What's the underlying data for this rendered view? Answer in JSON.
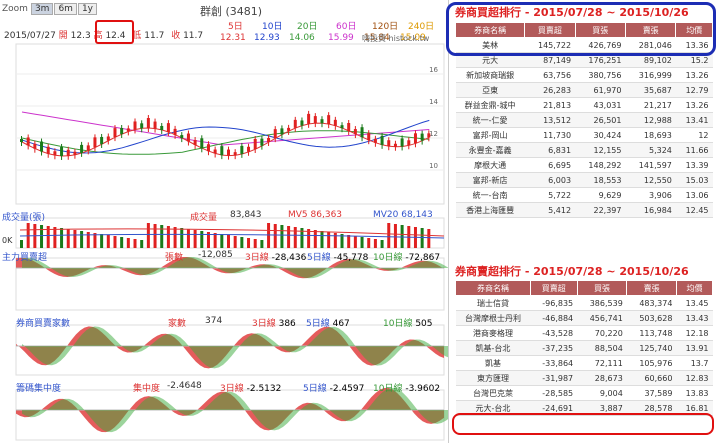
{
  "zoom": {
    "label": "Zoom",
    "buttons": [
      "3m",
      "6m",
      "1y"
    ]
  },
  "stock": {
    "title": "群創 (3481)"
  },
  "info": {
    "date": "2015/07/27",
    "open_label": "開",
    "open": "12.3",
    "high_label": "高",
    "high": "12.4",
    "low_label": "低",
    "low": "11.7",
    "close_label": "收",
    "close": "11.7"
  },
  "ma": [
    {
      "label": "5日",
      "value": "12.31",
      "color": "#d33"
    },
    {
      "label": "10日",
      "value": "12.93",
      "color": "#2244cc"
    },
    {
      "label": "20日",
      "value": "14.06",
      "color": "#3a9a3a"
    },
    {
      "label": "60日",
      "value": "15.99",
      "color": "#cc33cc"
    },
    {
      "label": "120日",
      "value": "15.84",
      "color": "#a05010"
    },
    {
      "label": "240日",
      "value": "15.09",
      "color": "#dd9900"
    }
  ],
  "credit": "嗨投資 histock.tw",
  "price_axis": [
    "16",
    "14",
    "12",
    "10"
  ],
  "volume": {
    "title": "成交量(張)",
    "vol_label": "成交量",
    "vol": "83,843",
    "mv5_label": "MV5",
    "mv5": "86,363",
    "mv20_label": "MV20",
    "mv20": "68,143",
    "axis": "0K"
  },
  "main_force": {
    "title": "主力買賣超",
    "unit": "張數",
    "value": "-12,085",
    "d3_label": "3日線",
    "d3": "-28,436",
    "d5_label": "5日線",
    "d5": "-45,778",
    "d10_label": "10日線",
    "d10": "-72,867"
  },
  "brokers_count": {
    "title": "券商買賣家數",
    "unit": "家數",
    "value": "374",
    "d3_label": "3日線",
    "d3": "386",
    "d5_label": "5日線",
    "d5": "467",
    "d10_label": "10日線",
    "d10": "505"
  },
  "concentration": {
    "title": "籌碼集中度",
    "unit": "集中度",
    "value": "-2.4648",
    "d3_label": "3日線",
    "d3": "-2.5132",
    "d5_label": "5日線",
    "d5": "-2.4597",
    "d10_label": "10日線",
    "d10": "-3.9602"
  },
  "buy_table": {
    "title": "券商買超排行 - 2015/07/28 ~ 2015/10/26",
    "headers": [
      "券商名稱",
      "買賣超",
      "買張",
      "賣張",
      "均價"
    ],
    "rows": [
      [
        "美林",
        "145,722",
        "426,769",
        "281,046",
        "13.36"
      ],
      [
        "元大",
        "87,149",
        "176,251",
        "89,102",
        "15.2"
      ],
      [
        "新加坡商瑞銀",
        "63,756",
        "380,756",
        "316,999",
        "13.26"
      ],
      [
        "亞東",
        "26,283",
        "61,970",
        "35,687",
        "12.79"
      ],
      [
        "群益金鼎-城中",
        "21,813",
        "43,031",
        "21,217",
        "13.26"
      ],
      [
        "統一-仁愛",
        "13,512",
        "26,501",
        "12,988",
        "13.41"
      ],
      [
        "富邦-岡山",
        "11,730",
        "30,424",
        "18,693",
        "12"
      ],
      [
        "永豐金-嘉義",
        "6,831",
        "12,155",
        "5,324",
        "11.66"
      ],
      [
        "摩根大通",
        "6,695",
        "148,292",
        "141,597",
        "13.39"
      ],
      [
        "富邦-新店",
        "6,003",
        "18,553",
        "12,550",
        "15.03"
      ],
      [
        "統一-台南",
        "5,722",
        "9,629",
        "3,906",
        "13.06"
      ],
      [
        "香港上海匯豐",
        "5,412",
        "22,397",
        "16,984",
        "12.45"
      ]
    ]
  },
  "sell_table": {
    "title": "券商賣超排行 - 2015/07/28 ~ 2015/10/26",
    "headers": [
      "券商名稱",
      "買賣超",
      "買張",
      "賣張",
      "均價"
    ],
    "rows": [
      [
        "瑞士信貸",
        "-96,835",
        "386,539",
        "483,374",
        "13.45"
      ],
      [
        "台灣摩根士丹利",
        "-46,884",
        "456,741",
        "503,628",
        "13.43"
      ],
      [
        "港商麥格理",
        "-43,528",
        "70,220",
        "113,748",
        "12.18"
      ],
      [
        "凱基-台北",
        "-37,235",
        "88,504",
        "125,740",
        "13.91"
      ],
      [
        "凱基",
        "-33,864",
        "72,111",
        "105,976",
        "13.7"
      ],
      [
        "東方匯理",
        "-31,987",
        "28,673",
        "60,660",
        "12.83"
      ],
      [
        "台灣巴克萊",
        "-28,585",
        "9,004",
        "37,589",
        "13.83"
      ],
      [
        "元大-台北",
        "-24,691",
        "3,887",
        "28,578",
        "16.81"
      ]
    ]
  }
}
